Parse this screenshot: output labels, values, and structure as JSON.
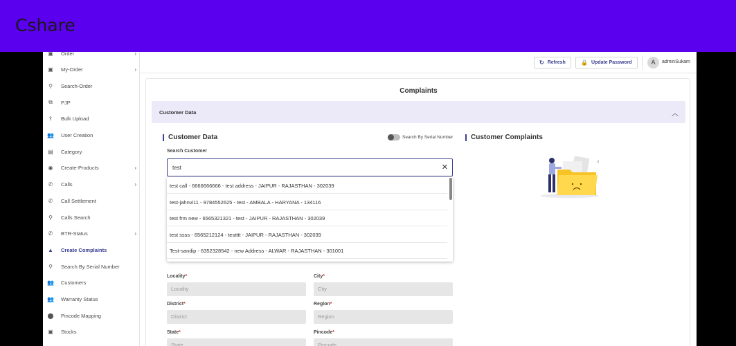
{
  "banner": {
    "title": "Cshare"
  },
  "sidebar": {
    "items": [
      {
        "label": "Order",
        "icon": "box-icon",
        "glyph": "▣",
        "chevron": true,
        "active": false
      },
      {
        "label": "My-Order",
        "icon": "box-icon",
        "glyph": "▣",
        "chevron": true,
        "active": false
      },
      {
        "label": "Search-Order",
        "icon": "search-icon",
        "glyph": "⚲",
        "chevron": false,
        "active": false
      },
      {
        "label": "PJP",
        "icon": "sitemap-icon",
        "glyph": "⧉",
        "chevron": false,
        "active": false
      },
      {
        "label": "Bulk Upload",
        "icon": "upload-icon",
        "glyph": "⇪",
        "chevron": false,
        "active": false
      },
      {
        "label": "User Creation",
        "icon": "users-icon",
        "glyph": "👥",
        "chevron": false,
        "active": false
      },
      {
        "label": "Category",
        "icon": "category-icon",
        "glyph": "▤",
        "chevron": false,
        "active": false
      },
      {
        "label": "Create-Products",
        "icon": "product-icon",
        "glyph": "◉",
        "chevron": true,
        "active": false
      },
      {
        "label": "Calls",
        "icon": "phone-icon",
        "glyph": "✆",
        "chevron": true,
        "active": false
      },
      {
        "label": "Call Settlement",
        "icon": "phone-icon",
        "glyph": "✆",
        "chevron": false,
        "active": false
      },
      {
        "label": "Calls Search",
        "icon": "search-icon",
        "glyph": "⚲",
        "chevron": false,
        "active": false
      },
      {
        "label": "BTR-Status",
        "icon": "phone-icon",
        "glyph": "✆",
        "chevron": true,
        "active": false
      },
      {
        "label": "Create Complaints",
        "icon": "warning-icon",
        "glyph": "▲",
        "chevron": false,
        "active": true
      },
      {
        "label": "Search By Serial Number",
        "icon": "search-icon",
        "glyph": "⚲",
        "chevron": false,
        "active": false
      },
      {
        "label": "Customers",
        "icon": "users-icon",
        "glyph": "👥",
        "chevron": false,
        "active": false
      },
      {
        "label": "Warranty Status",
        "icon": "users-icon",
        "glyph": "👥",
        "chevron": false,
        "active": false
      },
      {
        "label": "Pincode Mapping",
        "icon": "location-pin-icon",
        "glyph": "⬤",
        "chevron": false,
        "active": false
      },
      {
        "label": "Stocks",
        "icon": "box-icon",
        "glyph": "▣",
        "chevron": false,
        "active": false
      }
    ]
  },
  "topbar": {
    "refresh_label": "Refresh",
    "update_password_label": "Update Password",
    "avatar_letter": "A",
    "username": "adminSukam"
  },
  "page": {
    "title": "Complaints",
    "accordion_title": "Customer Data",
    "left_section_title": "Customer Data",
    "right_section_title": "Customer Complaints",
    "toggle_label": "Search By Serial Number",
    "search_label": "Search Customer",
    "search_value": "test"
  },
  "dropdown": {
    "items": [
      "test call - 6666666666 - test address - JAIPUR - RAJASTHAN - 302039",
      "test-jahnvi11 - 9784552625 - test - AMBALA - HARYANA - 134116",
      "test frm new - 6565321321 - test - JAIPUR - RAJASTHAN - 302039",
      "test ssss - 6565212124 - testttt - JAIPUR - RAJASTHAN - 302039",
      "Test-sandip - 6352328542 - new Address - ALWAR - RAJASTHAN - 301001"
    ]
  },
  "form": {
    "locality_label": "Locality",
    "locality_placeholder": "Locality",
    "city_label": "City",
    "city_placeholder": "City",
    "district_label": "District",
    "district_placeholder": "District",
    "region_label": "Region",
    "region_placeholder": "Region",
    "state_label": "State",
    "state_placeholder": "State",
    "pincode_label": "Pincode",
    "pincode_placeholder": "Pincode",
    "required_mark": "*"
  },
  "colors": {
    "banner": "#5b00ee",
    "accent": "#3b3f8f",
    "accordion_bg": "#eceaf8",
    "illustration_yellow": "#f7c325"
  }
}
